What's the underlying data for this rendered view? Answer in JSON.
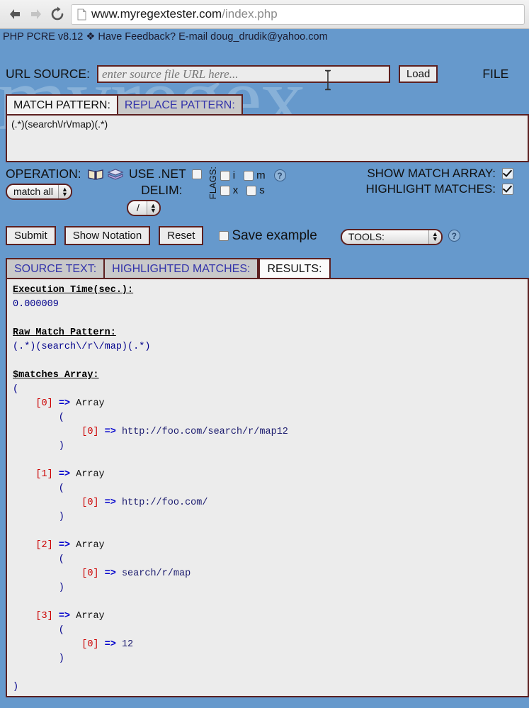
{
  "browser": {
    "back_icon": "arrow-left-icon",
    "forward_icon": "arrow-right-icon",
    "reload_icon": "reload-icon",
    "page_icon": "page-icon",
    "url_host": "www.myregextester.com",
    "url_path": "/index.php"
  },
  "site": {
    "pcre_line": "PHP PCRE v8.12 ❖ Have Feedback?  E-mail doug_drudik@yahoo.com",
    "watermark": "myregex"
  },
  "url_source": {
    "label": "URL SOURCE:",
    "placeholder": "enter source file URL here...",
    "value": "",
    "load_label": "Load",
    "file_label": "FILE"
  },
  "pattern": {
    "tabs": [
      {
        "label": "MATCH PATTERN:",
        "active": true
      },
      {
        "label": "REPLACE PATTERN:",
        "active": false
      }
    ],
    "value": "(.*)(search\\/r\\/map)(.*)"
  },
  "operation": {
    "label": "OPERATION:",
    "book_icon": "book-icon",
    "drawer_icon": "drawer-icon",
    "select_value": "match all",
    "use_net_label": "USE .NET",
    "use_net_checked": false,
    "delim_label": "DELIM:",
    "delim_value": "/"
  },
  "flags": {
    "label": "FLAGS:",
    "items": [
      {
        "name": "i",
        "checked": false
      },
      {
        "name": "m",
        "checked": false
      },
      {
        "name": "x",
        "checked": false
      },
      {
        "name": "s",
        "checked": false
      }
    ],
    "help_icon": "help-icon"
  },
  "options": {
    "show_match_array_label": "SHOW MATCH ARRAY:",
    "show_match_array_checked": true,
    "highlight_matches_label": "HIGHLIGHT MATCHES:",
    "highlight_matches_checked": true
  },
  "actions": {
    "submit_label": "Submit",
    "show_notation_label": "Show Notation",
    "reset_label": "Reset",
    "save_example_label": "Save example",
    "save_example_checked": false,
    "tools_label": "TOOLS:",
    "tools_help_icon": "help-icon"
  },
  "result_tabs": [
    {
      "label": "SOURCE TEXT:",
      "active": false
    },
    {
      "label": "HIGHLIGHTED MATCHES:",
      "active": false
    },
    {
      "label": "RESULTS:",
      "active": true
    }
  ],
  "results": {
    "exec_time_label": "Execution Time(sec.):",
    "exec_time_value": "0.000009",
    "raw_pattern_label": "Raw Match Pattern:",
    "raw_pattern_value": "(.*)(search\\/r\\/map)(.*)",
    "matches_label": "$matches Array:",
    "matches": [
      {
        "index": "0",
        "value": "http://foo.com/search/r/map12"
      },
      {
        "index": "1",
        "value": "http://foo.com/"
      },
      {
        "index": "2",
        "value": "search/r/map"
      },
      {
        "index": "3",
        "value": "12"
      }
    ]
  },
  "colors": {
    "page_background": "#6699cc",
    "panel": "#ececec",
    "border": "#5c2020",
    "index_red": "#cc0000",
    "arrow_blue": "#0000cc",
    "value_blue": "#00008b"
  }
}
